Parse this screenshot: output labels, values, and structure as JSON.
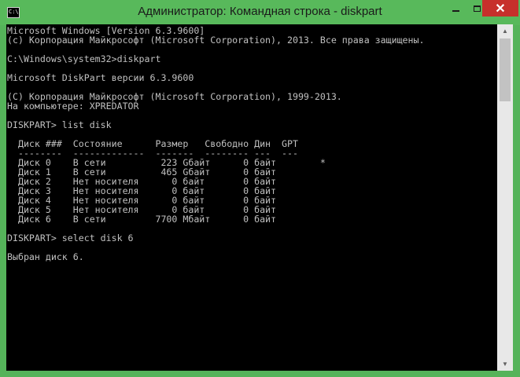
{
  "window": {
    "title": "Администратор: Командная строка - diskpart",
    "icon_label": "C:\\",
    "controls": {
      "minimize": "minimize-icon",
      "maximize": "maximize-icon",
      "close": "close-icon"
    }
  },
  "console": {
    "lines": [
      "Microsoft Windows [Version 6.3.9600]",
      "(c) Корпорация Майкрософт (Microsoft Corporation), 2013. Все права защищены.",
      "",
      "C:\\Windows\\system32>diskpart",
      "",
      "Microsoft DiskPart версии 6.3.9600",
      "",
      "(C) Корпорация Майкрософт (Microsoft Corporation), 1999-2013.",
      "На компьютере: XPREDATOR",
      "",
      "DISKPART> list disk",
      "",
      "  Диск ###  Состояние      Размер   Свободно Дин  GPT",
      "  --------  -------------  -------  -------- ---  ---",
      "  Диск 0    В сети          223 Gбайт      0 байт        *",
      "  Диск 1    В сети          465 Gбайт      0 байт",
      "  Диск 2    Нет носителя      0 байт       0 байт",
      "  Диск 3    Нет носителя      0 байт       0 байт",
      "  Диск 4    Нет носителя      0 байт       0 байт",
      "  Диск 5    Нет носителя      0 байт       0 байт",
      "  Диск 6    В сети         7700 Мбайт      0 байт",
      "",
      "DISKPART> select disk 6",
      "",
      "Выбран диск 6.",
      ""
    ]
  }
}
